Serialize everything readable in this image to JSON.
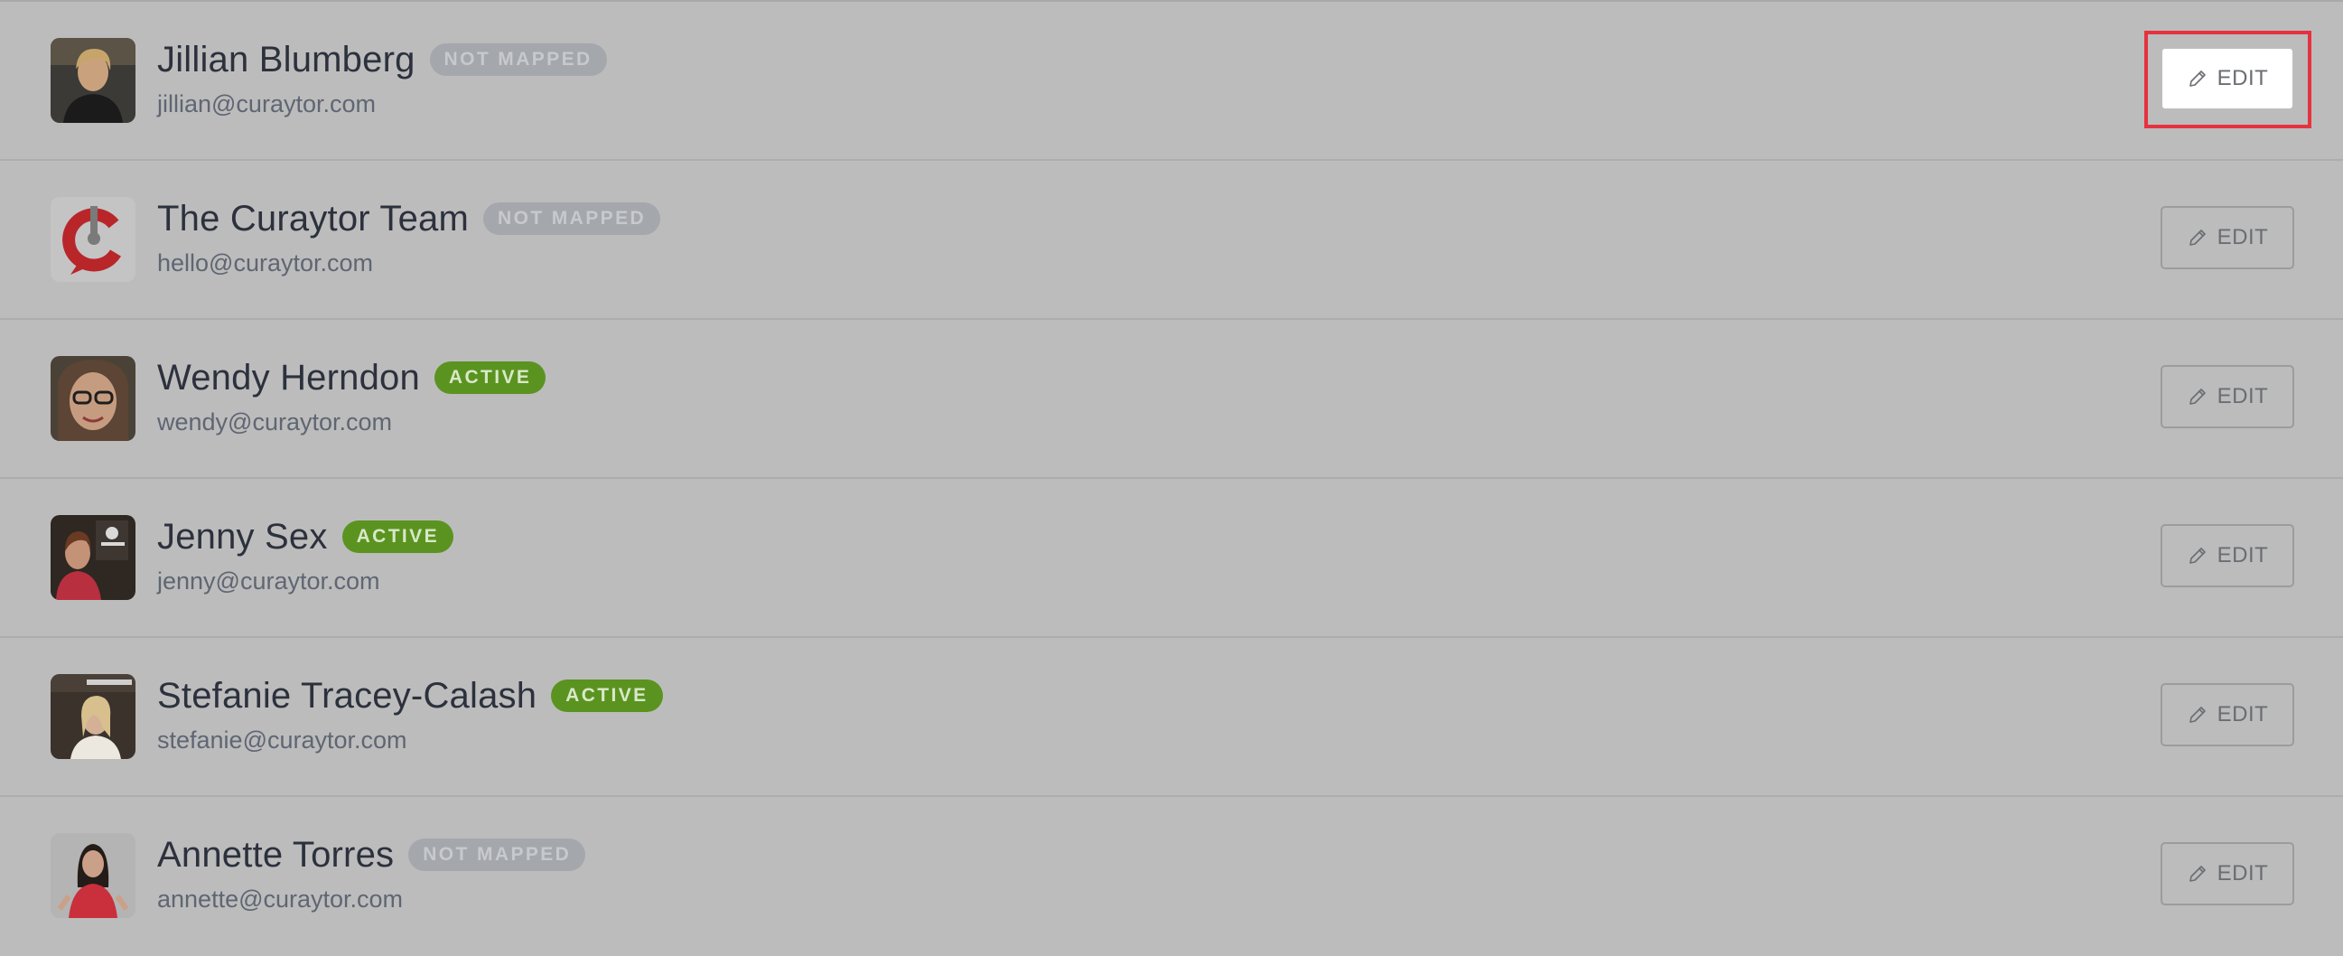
{
  "users": [
    {
      "name": "Jillian Blumberg",
      "status": "NOT MAPPED",
      "email": "jillian@curaytor.com",
      "avatar": "photo-avatar",
      "edit_label": "EDIT"
    },
    {
      "name": "The Curaytor Team",
      "status": "NOT MAPPED",
      "email": "hello@curaytor.com",
      "avatar": "curaytor-logo-icon",
      "edit_label": "EDIT"
    },
    {
      "name": "Wendy Herndon",
      "status": "ACTIVE",
      "email": "wendy@curaytor.com",
      "avatar": "photo-avatar",
      "edit_label": "EDIT"
    },
    {
      "name": "Jenny Sex",
      "status": "ACTIVE",
      "email": "jenny@curaytor.com",
      "avatar": "photo-avatar",
      "edit_label": "EDIT"
    },
    {
      "name": "Stefanie Tracey-Calash",
      "status": "ACTIVE",
      "email": "stefanie@curaytor.com",
      "avatar": "photo-avatar",
      "edit_label": "EDIT"
    },
    {
      "name": "Annette Torres",
      "status": "NOT MAPPED",
      "email": "annette@curaytor.com",
      "avatar": "photo-avatar",
      "edit_label": "EDIT"
    }
  ],
  "colors": {
    "overlay_background": "#bcbcbc",
    "active_badge": "#5b9320",
    "not_mapped_badge": "#a4a7ac",
    "highlight_frame": "#e5323f",
    "logo_red": "#b8262a"
  },
  "icons": {
    "edit": "pencil-icon"
  }
}
